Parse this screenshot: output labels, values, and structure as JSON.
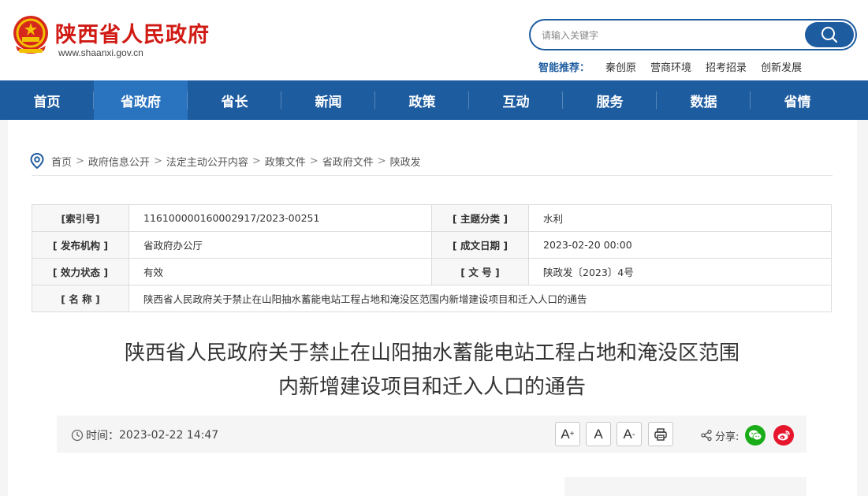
{
  "header": {
    "site_name": "陕西省人民政府",
    "site_url": "www.shaanxi.gov.cn",
    "search_placeholder": "请输入关键字",
    "smart_label": "智能推荐：",
    "smart_links": [
      "秦创原",
      "营商环境",
      "招考招录",
      "创新发展"
    ]
  },
  "nav": [
    "首页",
    "省政府",
    "省长",
    "新闻",
    "政策",
    "互动",
    "服务",
    "数据",
    "省情"
  ],
  "nav_active_index": 1,
  "breadcrumb": [
    "首页",
    "政府信息公开",
    "法定主动公开内容",
    "政策文件",
    "省政府文件",
    "陕政发"
  ],
  "meta": {
    "index_no_label": "[索引号]",
    "index_no": "116100000160002917/2023-00251",
    "topic_label": "[ 主题分类 ]",
    "topic": "水利",
    "issuer_label": "[ 发布机构 ]",
    "issuer": "省政府办公厅",
    "date_label": "[ 成文日期 ]",
    "date": "2023-02-20 00:00",
    "status_label": "[ 效力状态 ]",
    "status": "有效",
    "doc_no_label": "[ 文 号 ]",
    "doc_no": "陕政发〔2023〕4号",
    "name_label": "[ 名 称 ]",
    "name": "陕西省人民政府关于禁止在山阳抽水蓄能电站工程占地和淹没区范围内新增建设项目和迁入人口的通告"
  },
  "article": {
    "title_line1": "陕西省人民政府关于禁止在山阳抽水蓄能电站工程占地和淹没区范围",
    "title_line2": "内新增建设项目和迁入人口的通告",
    "time_label": "时间：",
    "time": "2023-02-22 14:47"
  },
  "toolbar": {
    "font_large": "A",
    "font_large_sup": "+",
    "font_normal": "A",
    "font_small": "A",
    "font_small_sup": "-",
    "share_label": "分享:"
  },
  "colors": {
    "brand_blue": "#1e5ca0",
    "brand_red": "#d01a14",
    "wechat_green": "#1aad19",
    "weibo_red": "#e6162d"
  }
}
